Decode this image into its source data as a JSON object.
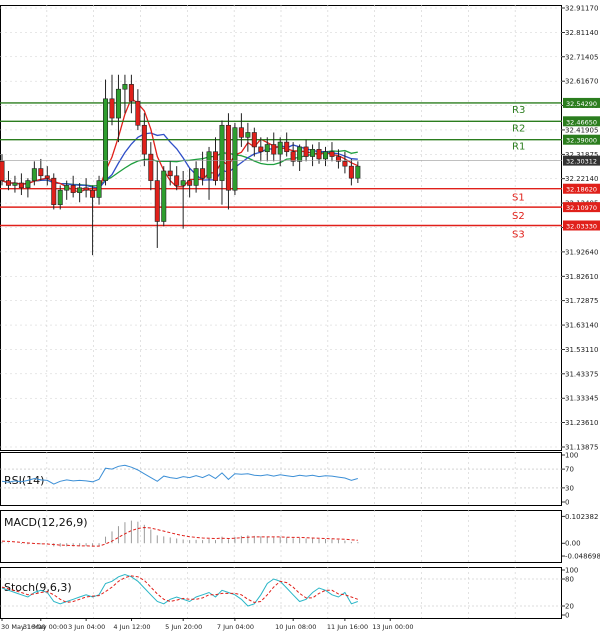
{
  "chart_data": {
    "type": "candlestick",
    "title": "",
    "grid": true,
    "colors": {
      "bull": "#2e9e2e",
      "bear": "#e0201a",
      "grid": "#cfcfcf",
      "ma_fast": "#e0201a",
      "ma_mid": "#2f4fc8",
      "ma_slow": "#1e9e3e",
      "resistance": "#2b7d1e",
      "support": "#e0201a",
      "current": "#333333",
      "rsi": "#3c8fd6",
      "macd_hist": "#9a9a9a",
      "macd_signal": "#e0201a",
      "stoch_main": "#2ab6c7",
      "stoch_signal": "#e0201a"
    },
    "price_axis": {
      "ylim": [
        31.1,
        32.95
      ],
      "ticks": [
        "32.91170",
        "32.81140",
        "32.71405",
        "32.61670",
        "32.51640",
        "32.41905",
        "32.31875",
        "32.22140",
        "32.12405",
        "32.02375",
        "31.92640",
        "31.82610",
        "31.72875",
        "31.63140",
        "31.53110",
        "31.43375",
        "31.33345",
        "31.23610",
        "31.13875"
      ]
    },
    "time_axis": {
      "labels": [
        {
          "index": 0,
          "text": "30 May 16:00"
        },
        {
          "index": 6,
          "text": "31 May 00:00"
        },
        {
          "index": 13,
          "text": "3 Jun 04:00"
        },
        {
          "index": 20,
          "text": "4 Jun 12:00"
        },
        {
          "index": 28,
          "text": "5 Jun 20:00"
        },
        {
          "index": 36,
          "text": "7 Jun 04:00"
        },
        {
          "index": 45,
          "text": "10 Jun 08:00"
        },
        {
          "index": 53,
          "text": "11 Jun 16:00"
        },
        {
          "index": 60,
          "text": "13 Jun 00:00"
        }
      ]
    },
    "levels": [
      {
        "name": "R3",
        "value": 32.5429,
        "price_label": "32.54290",
        "kind": "resistance"
      },
      {
        "name": "R2",
        "value": 32.4665,
        "price_label": "32.46650",
        "kind": "resistance"
      },
      {
        "name": "R1",
        "value": 32.39,
        "price_label": "32.39000",
        "kind": "resistance"
      },
      {
        "name": "S1",
        "value": 32.1862,
        "price_label": "32.18620",
        "kind": "support"
      },
      {
        "name": "S2",
        "value": 32.1097,
        "price_label": "32.10970",
        "kind": "support"
      },
      {
        "name": "S3",
        "value": 32.0333,
        "price_label": "32.03330",
        "kind": "support"
      }
    ],
    "current_price": {
      "value": 32.30312,
      "label": "32.30312"
    },
    "candles": [
      [
        32.3,
        32.33,
        32.2,
        32.22
      ],
      [
        32.22,
        32.26,
        32.18,
        32.2
      ],
      [
        32.2,
        32.24,
        32.17,
        32.21
      ],
      [
        32.21,
        32.25,
        32.16,
        32.19
      ],
      [
        32.19,
        32.23,
        32.15,
        32.22
      ],
      [
        32.22,
        32.3,
        32.2,
        32.27
      ],
      [
        32.27,
        32.31,
        32.22,
        32.24
      ],
      [
        32.24,
        32.28,
        32.2,
        32.23
      ],
      [
        32.23,
        32.25,
        32.1,
        32.12
      ],
      [
        32.12,
        32.2,
        32.1,
        32.18
      ],
      [
        32.18,
        32.22,
        32.14,
        32.2
      ],
      [
        32.2,
        32.24,
        32.15,
        32.17
      ],
      [
        32.17,
        32.21,
        32.13,
        32.19
      ],
      [
        32.19,
        32.23,
        32.15,
        32.18
      ],
      [
        32.18,
        32.2,
        31.91,
        32.15
      ],
      [
        32.15,
        32.24,
        32.12,
        32.22
      ],
      [
        32.22,
        32.64,
        32.2,
        32.56
      ],
      [
        32.56,
        32.66,
        32.45,
        32.48
      ],
      [
        32.48,
        32.66,
        32.38,
        32.6
      ],
      [
        32.6,
        32.66,
        32.5,
        32.62
      ],
      [
        32.62,
        32.66,
        32.5,
        32.55
      ],
      [
        32.55,
        32.6,
        32.43,
        32.45
      ],
      [
        32.45,
        32.5,
        32.28,
        32.33
      ],
      [
        32.33,
        32.38,
        32.18,
        32.22
      ],
      [
        32.22,
        32.3,
        31.94,
        32.05
      ],
      [
        32.05,
        32.28,
        32.03,
        32.26
      ],
      [
        32.26,
        32.3,
        32.2,
        32.24
      ],
      [
        32.24,
        32.28,
        32.18,
        32.2
      ],
      [
        32.2,
        32.26,
        32.02,
        32.22
      ],
      [
        32.22,
        32.27,
        32.15,
        32.2
      ],
      [
        32.2,
        32.3,
        32.17,
        32.27
      ],
      [
        32.27,
        32.34,
        32.2,
        32.23
      ],
      [
        32.23,
        32.36,
        32.14,
        32.34
      ],
      [
        32.34,
        32.4,
        32.2,
        32.22
      ],
      [
        32.22,
        32.47,
        32.12,
        32.45
      ],
      [
        32.45,
        32.5,
        32.1,
        32.18
      ],
      [
        32.18,
        32.46,
        32.16,
        32.44
      ],
      [
        32.44,
        32.5,
        32.36,
        32.4
      ],
      [
        32.4,
        32.46,
        32.34,
        32.42
      ],
      [
        32.42,
        32.44,
        32.32,
        32.36
      ],
      [
        32.36,
        32.4,
        32.3,
        32.34
      ],
      [
        32.34,
        32.4,
        32.3,
        32.37
      ],
      [
        32.37,
        32.42,
        32.3,
        32.33
      ],
      [
        32.33,
        32.4,
        32.28,
        32.38
      ],
      [
        32.38,
        32.42,
        32.32,
        32.34
      ],
      [
        32.34,
        32.38,
        32.28,
        32.3
      ],
      [
        32.3,
        32.37,
        32.26,
        32.36
      ],
      [
        32.36,
        32.39,
        32.3,
        32.32
      ],
      [
        32.32,
        32.37,
        32.28,
        32.35
      ],
      [
        32.35,
        32.38,
        32.29,
        32.31
      ],
      [
        32.31,
        32.36,
        32.28,
        32.34
      ],
      [
        32.34,
        32.38,
        32.3,
        32.32
      ],
      [
        32.32,
        32.35,
        32.27,
        32.3
      ],
      [
        32.3,
        32.34,
        32.25,
        32.28
      ],
      [
        32.28,
        32.31,
        32.2,
        32.23
      ],
      [
        32.23,
        32.3,
        32.21,
        32.28
      ]
    ],
    "indicators": [
      {
        "name": "RSI(14)",
        "ticks": [
          "100",
          "70",
          "30",
          "0"
        ],
        "ylim": [
          0,
          100
        ],
        "values": [
          44,
          42,
          45,
          43,
          46,
          50,
          47,
          46,
          38,
          44,
          47,
          45,
          46,
          45,
          43,
          48,
          72,
          70,
          76,
          78,
          74,
          68,
          60,
          52,
          44,
          55,
          52,
          50,
          54,
          52,
          56,
          52,
          58,
          50,
          62,
          48,
          60,
          59,
          60,
          57,
          56,
          58,
          55,
          58,
          56,
          54,
          57,
          55,
          57,
          54,
          56,
          55,
          53,
          51,
          46,
          50
        ]
      },
      {
        "name": "MACD(12,26,9)",
        "ticks": [
          "0.102382",
          "0.00",
          "-0.048698"
        ],
        "ylim": [
          -0.06,
          0.115
        ],
        "histogram": [
          0.005,
          0.002,
          0.0,
          -0.003,
          -0.004,
          -0.002,
          -0.004,
          -0.005,
          -0.012,
          -0.013,
          -0.012,
          -0.012,
          -0.011,
          -0.011,
          -0.013,
          -0.01,
          0.025,
          0.045,
          0.065,
          0.08,
          0.086,
          0.082,
          0.07,
          0.052,
          0.03,
          0.026,
          0.022,
          0.018,
          0.014,
          0.012,
          0.013,
          0.012,
          0.016,
          0.012,
          0.025,
          0.015,
          0.024,
          0.028,
          0.03,
          0.028,
          0.026,
          0.025,
          0.022,
          0.024,
          0.022,
          0.019,
          0.02,
          0.018,
          0.018,
          0.016,
          0.016,
          0.015,
          0.013,
          0.01,
          0.005,
          0.004
        ],
        "signal": [
          0.008,
          0.007,
          0.005,
          0.003,
          0.001,
          -0.001,
          -0.002,
          -0.003,
          -0.005,
          -0.007,
          -0.008,
          -0.009,
          -0.01,
          -0.01,
          -0.011,
          -0.011,
          -0.003,
          0.008,
          0.022,
          0.036,
          0.048,
          0.056,
          0.06,
          0.058,
          0.052,
          0.046,
          0.04,
          0.034,
          0.029,
          0.025,
          0.022,
          0.02,
          0.019,
          0.018,
          0.019,
          0.018,
          0.019,
          0.021,
          0.023,
          0.024,
          0.024,
          0.024,
          0.024,
          0.024,
          0.023,
          0.022,
          0.022,
          0.021,
          0.02,
          0.019,
          0.018,
          0.017,
          0.016,
          0.015,
          0.013,
          0.011
        ]
      },
      {
        "name": "Stoch(9,6,3)",
        "ticks": [
          "100",
          "80",
          "20",
          "0"
        ],
        "ylim": [
          0,
          100
        ],
        "main": [
          60,
          55,
          50,
          45,
          40,
          50,
          55,
          50,
          30,
          25,
          30,
          35,
          40,
          45,
          40,
          45,
          70,
          75,
          85,
          90,
          85,
          75,
          60,
          45,
          30,
          25,
          35,
          40,
          35,
          30,
          40,
          45,
          50,
          40,
          55,
          50,
          45,
          35,
          20,
          25,
          45,
          70,
          80,
          75,
          60,
          45,
          30,
          35,
          50,
          60,
          55,
          45,
          40,
          50,
          25,
          30
        ],
        "signal": [
          62,
          58,
          54,
          50,
          45,
          47,
          50,
          52,
          45,
          35,
          28,
          30,
          35,
          40,
          42,
          43,
          52,
          62,
          75,
          83,
          87,
          85,
          77,
          62,
          47,
          35,
          30,
          33,
          37,
          35,
          35,
          38,
          45,
          45,
          48,
          48,
          48,
          45,
          35,
          28,
          30,
          45,
          62,
          75,
          72,
          62,
          48,
          38,
          38,
          48,
          55,
          55,
          47,
          45,
          40,
          35
        ]
      }
    ]
  }
}
